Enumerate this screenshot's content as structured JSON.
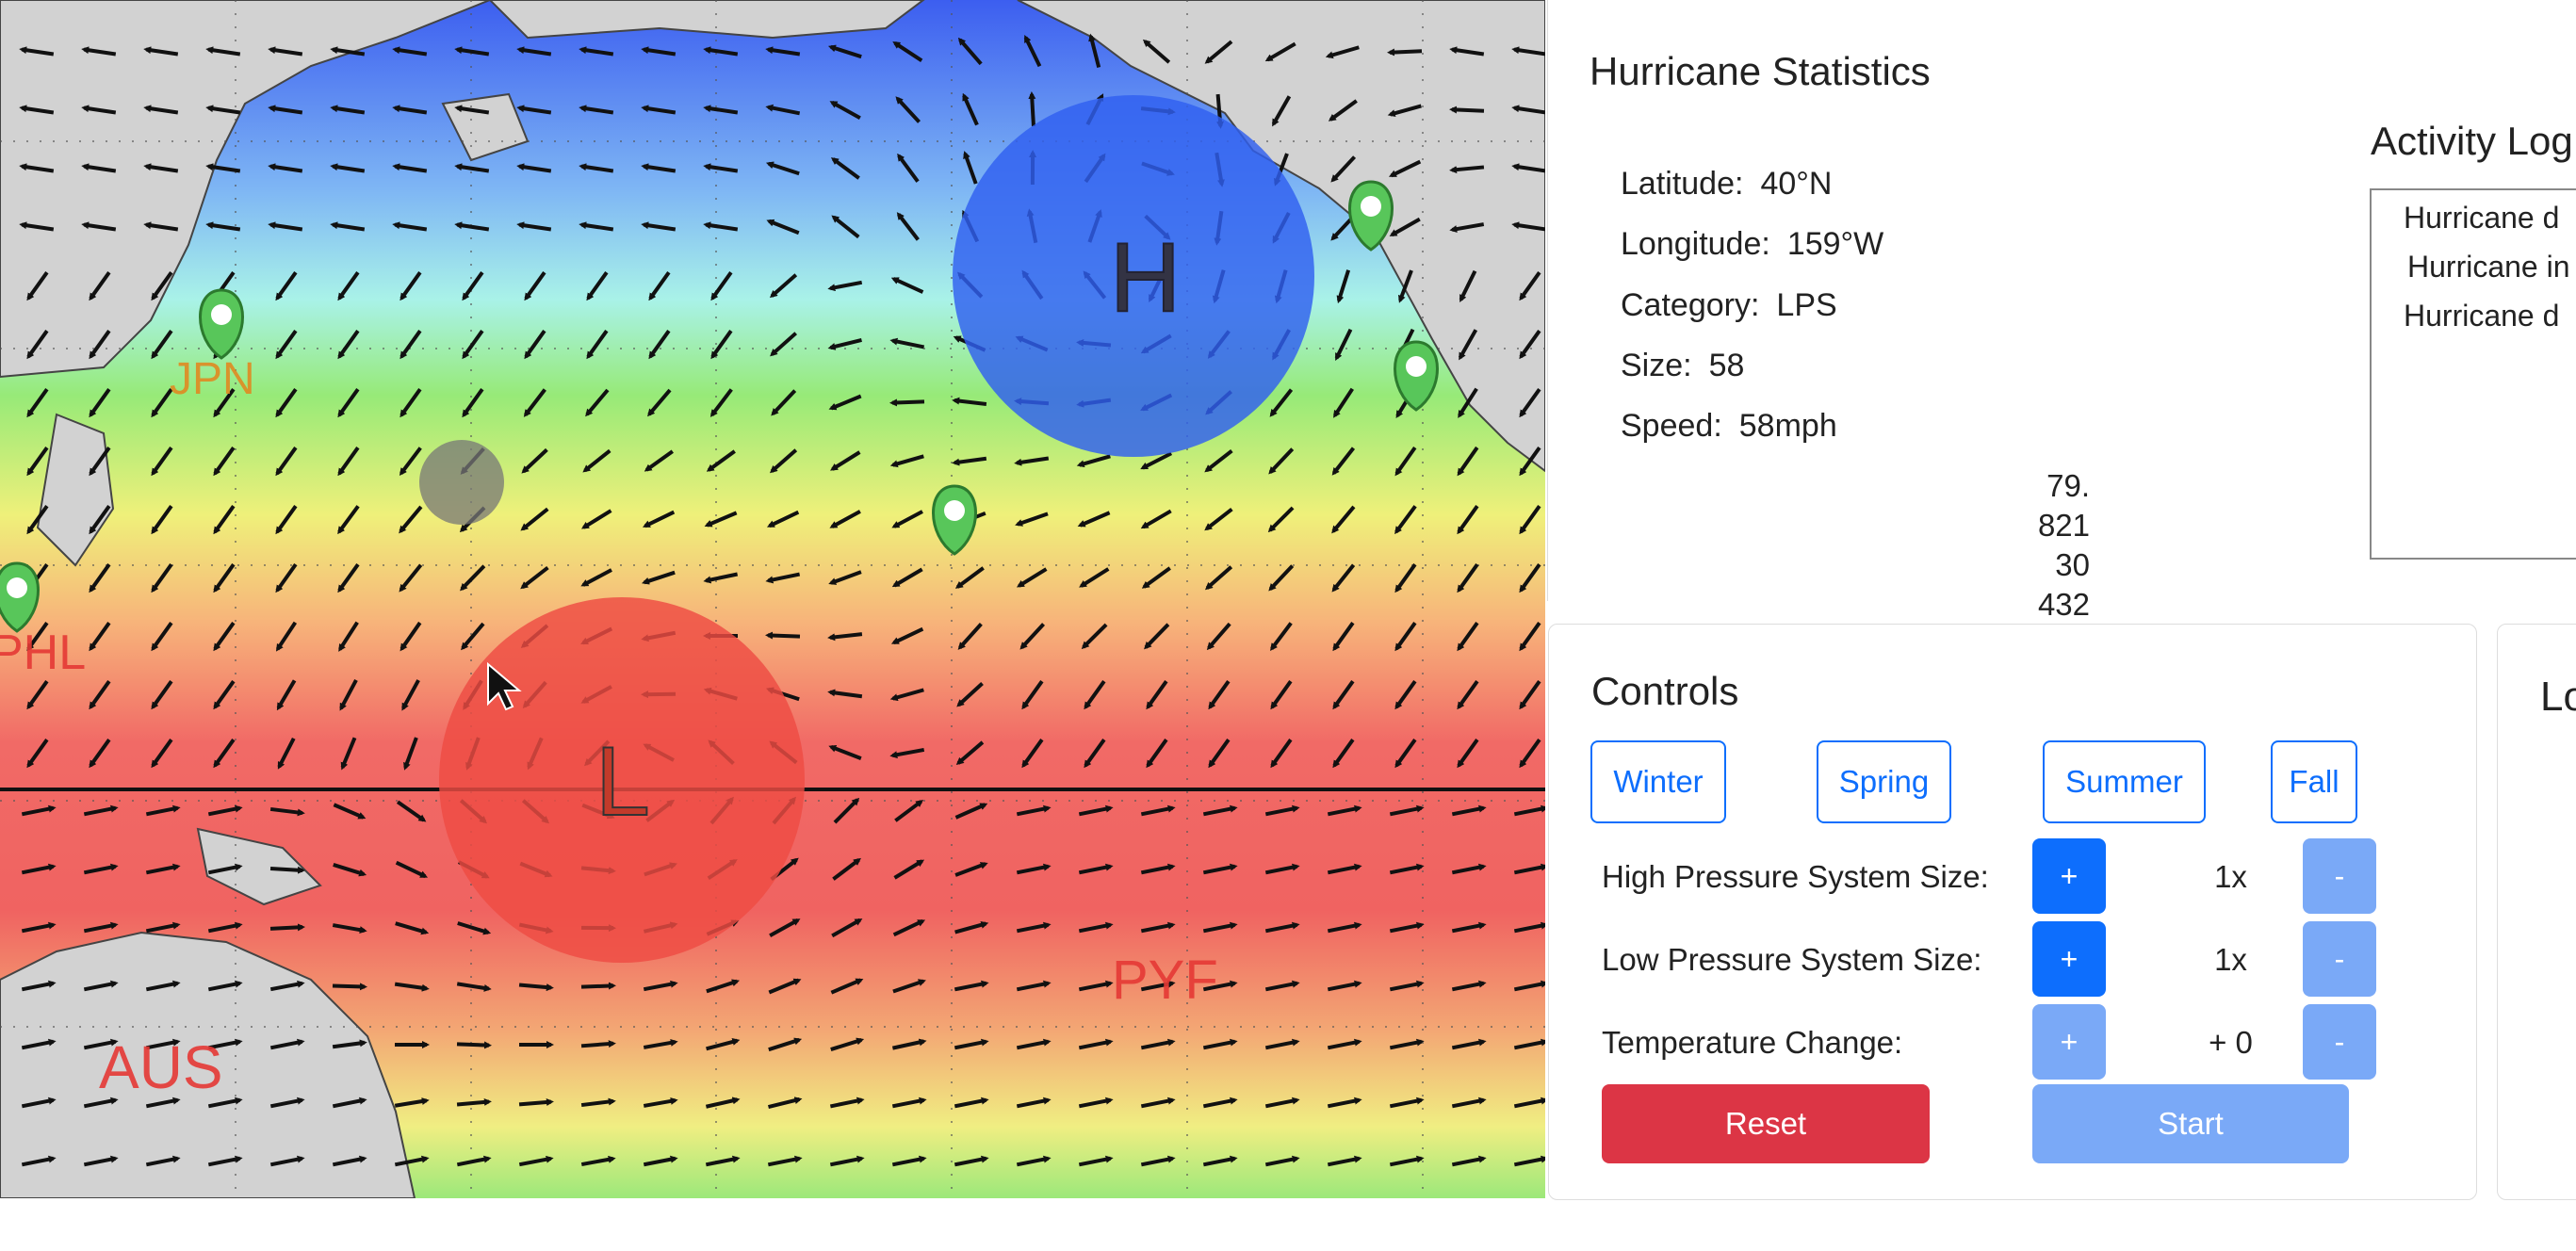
{
  "map": {
    "region_labels": [
      "JPN",
      "PHL",
      "AUS",
      "PYF"
    ],
    "high_pressure_letter": "H",
    "low_pressure_letter": "L",
    "colors": {
      "high_pressure": "#2f5ff0",
      "low_pressure": "#ee4c43",
      "marker": "#58c65a",
      "land": "#d2d2d2",
      "cold": "#4d7cf2",
      "warm": "#f1595b"
    }
  },
  "stats": {
    "title": "Hurricane Statistics",
    "rows": [
      {
        "label": "Latitude:",
        "value": "40°N"
      },
      {
        "label": "Longitude:",
        "value": "159°W"
      },
      {
        "label": "Category:",
        "value": "LPS"
      },
      {
        "label": "Size:",
        "value": "58"
      },
      {
        "label": "Speed:",
        "value": "58mph"
      }
    ],
    "numbers": [
      "79.",
      "821",
      "30",
      "432"
    ]
  },
  "activity": {
    "title": "Activity Log",
    "entries": [
      "Hurricane d",
      "Hurricane in",
      "Hurricane d"
    ]
  },
  "controls": {
    "title": "Controls",
    "seasons": [
      "Winter",
      "Spring",
      "Summer",
      "Fall"
    ],
    "rows": [
      {
        "label": "High Pressure System Size:",
        "plus": "+",
        "value": "1x",
        "minus": "-"
      },
      {
        "label": "Low Pressure System Size:",
        "plus": "+",
        "value": "1x",
        "minus": "-"
      },
      {
        "label": "Temperature Change:",
        "plus": "+",
        "value": "+ 0",
        "minus": "-"
      }
    ],
    "reset_label": "Reset",
    "start_label": "Start"
  },
  "side_panel": {
    "title": "Lo"
  }
}
